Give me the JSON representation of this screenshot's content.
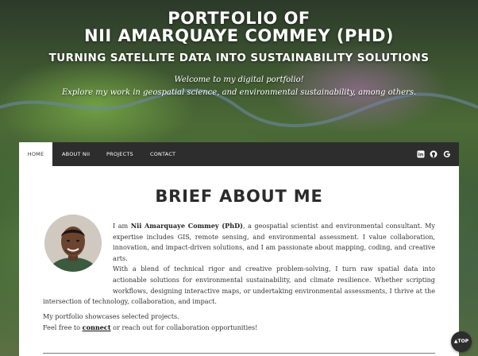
{
  "hero": {
    "title_line1": "PORTFOLIO OF",
    "title_line2": "NII AMARQUAYE COMMEY (PHD)",
    "subtitle": "TURNING SATELLITE DATA INTO SUSTAINABILITY SOLUTIONS",
    "welcome": "Welcome to my digital portfolio!",
    "explore": "Explore my work in geospatial science, and environmental sustainability, among others."
  },
  "nav": {
    "items": [
      {
        "label": "HOME",
        "active": true
      },
      {
        "label": "ABOUT NII"
      },
      {
        "label": "PROJECTS"
      },
      {
        "label": "CONTACT"
      }
    ],
    "icons": [
      {
        "name": "linkedin-icon",
        "glyph": "in"
      },
      {
        "name": "github-icon",
        "glyph": "●"
      },
      {
        "name": "google-scholar-icon",
        "glyph": "G"
      }
    ]
  },
  "about": {
    "heading": "BRIEF ABOUT ME",
    "bio_intro": "I am ",
    "bio_name": "Nii Amarquaye Commey (PhD)",
    "bio_rest": ", a geospatial scientist and environmental consultant. My expertise includes GIS, remote sensing, and environmental assessment. I value collaboration, innovation, and impact-driven solutions, and I am passionate about mapping, coding, and creative arts.",
    "bio_p2": "With a blend of technical rigor and creative problem-solving, I turn raw spatial data into actionable solutions for environmental sustainability, and climate resilience. Whether scripting workflows, designing interactive maps, or undertaking environmental assessments, I thrive at the intersection of technology, collaboration, and impact.",
    "showcase_line": "My portfolio showcases selected projects.",
    "feel_free_prefix": "Feel free to ",
    "connect_link": "connect",
    "feel_free_suffix": " or reach out for collaboration opportunities!"
  },
  "top_button": {
    "label": "TOP",
    "icon": "arrow-up-icon"
  }
}
